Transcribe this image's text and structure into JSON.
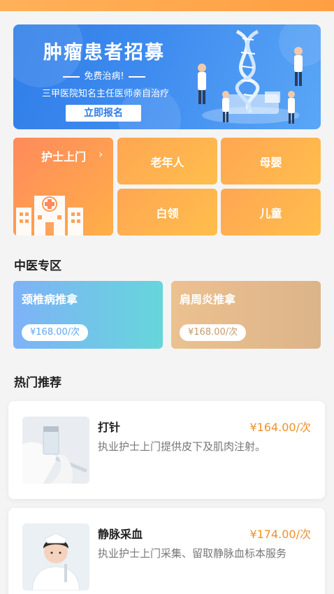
{
  "banner": {
    "title": "肿瘤患者招募",
    "subtitle": "免费治病!",
    "description": "三甲医院知名主任医师亲自治疗",
    "button_label": "立即报名"
  },
  "categories": {
    "featured": {
      "label": "护士上门",
      "chevron": "›",
      "icon": "hospital-icon"
    },
    "items": [
      {
        "label": "老年人"
      },
      {
        "label": "母婴"
      },
      {
        "label": "白领"
      },
      {
        "label": "儿童"
      }
    ]
  },
  "tcm": {
    "title": "中医专区",
    "cards": [
      {
        "name": "颈椎病推拿",
        "price": "¥168.00/次",
        "color": "#5fa6f0"
      },
      {
        "name": "肩周炎推拿",
        "price": "¥168.00/次",
        "color": "#dcb07c"
      }
    ]
  },
  "hot": {
    "title": "热门推荐",
    "items": [
      {
        "name": "打针",
        "price": "¥164.00/次",
        "description": "执业护士上门提供皮下及肌肉注射。"
      },
      {
        "name": "静脉采血",
        "price": "¥174.00/次",
        "description": "执业护士上门采集、留取静脉血标本服务"
      }
    ]
  },
  "colors": {
    "accent_orange": "#ffa652",
    "banner_blue": "#2f7de8",
    "price_orange": "#f0902b"
  }
}
